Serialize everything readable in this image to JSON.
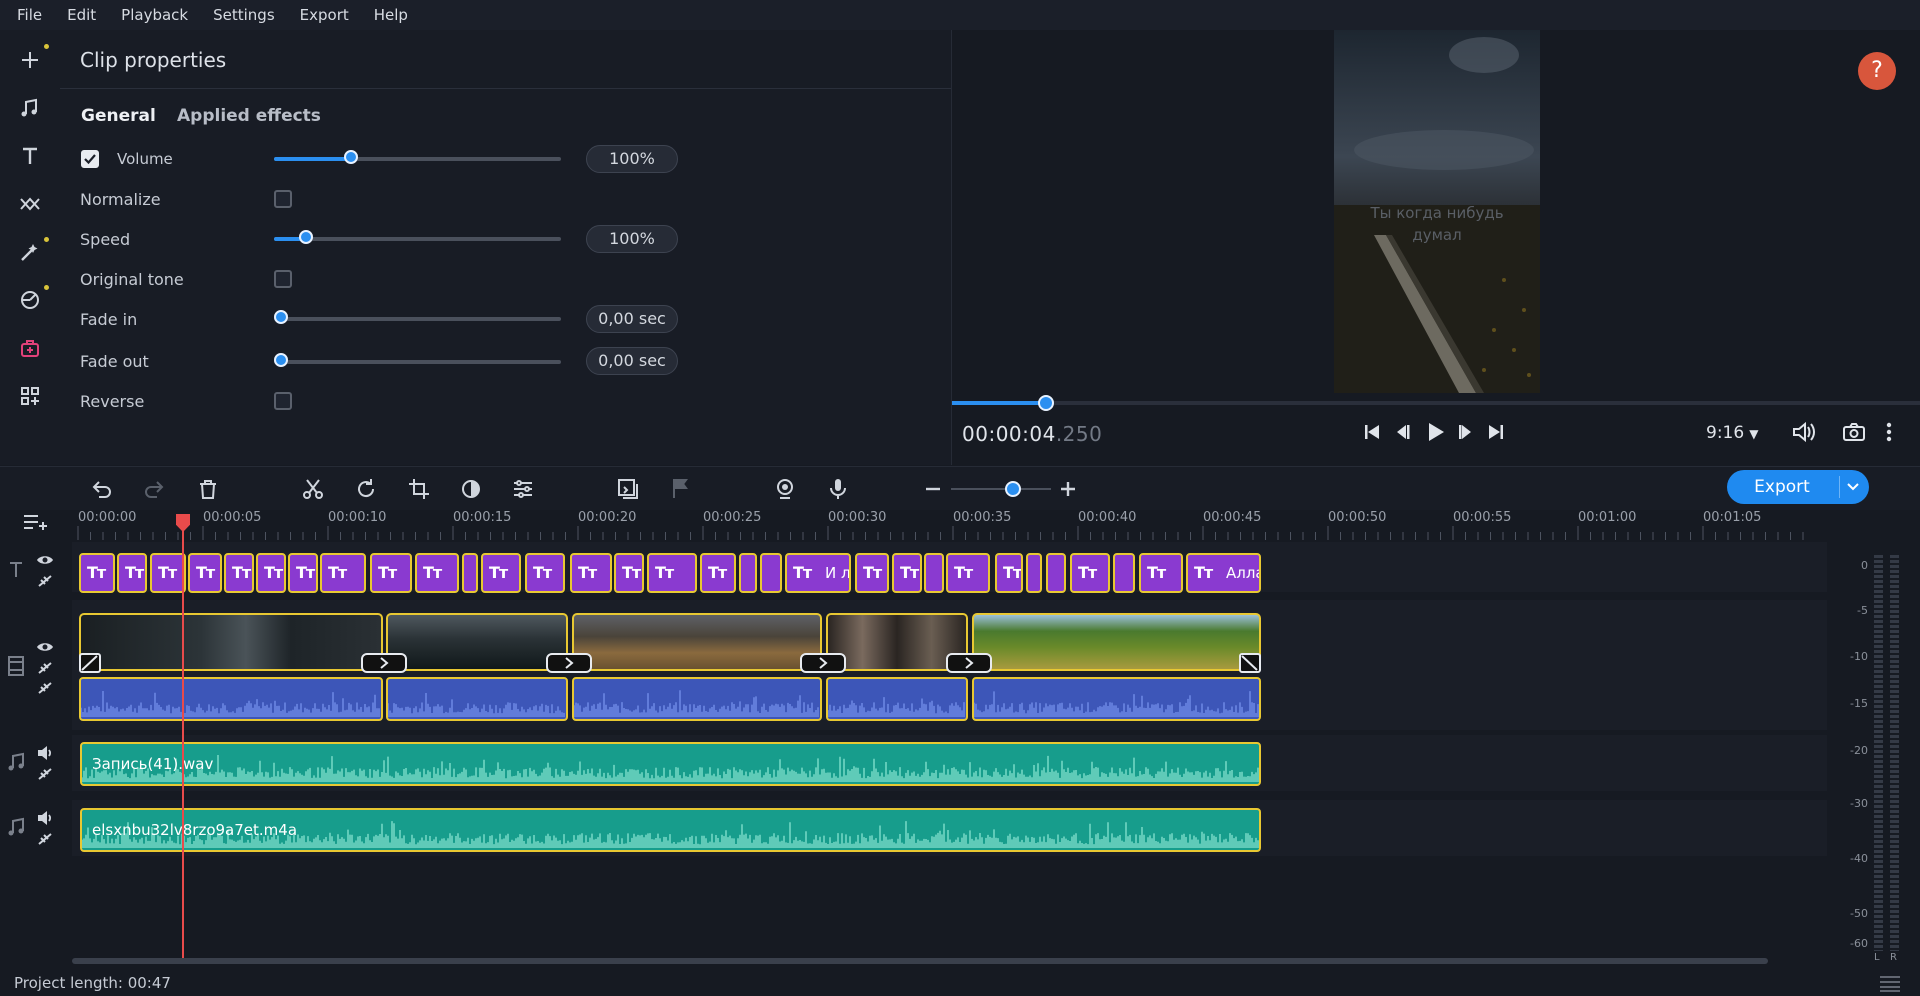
{
  "menu": [
    "File",
    "Edit",
    "Playback",
    "Settings",
    "Export",
    "Help"
  ],
  "props": {
    "title": "Clip properties",
    "tabs": [
      "General",
      "Applied effects"
    ],
    "volume_label": "Volume",
    "volume_value": "100%",
    "volume_level": 0.27,
    "normalize_label": "Normalize",
    "speed_label": "Speed",
    "speed_value": "100%",
    "speed_level": 0.11,
    "original_tone_label": "Original tone",
    "fade_in_label": "Fade in",
    "fade_in_value": "0,00 sec",
    "fade_out_label": "Fade out",
    "fade_out_value": "0,00 sec",
    "reverse_label": "Reverse"
  },
  "preview": {
    "subtitle_line1": "Ты когда нибудь",
    "subtitle_line2": "думал",
    "timecode": "00:00:04",
    "timecode_ms": ".250",
    "aspect": "9:16",
    "help": "?"
  },
  "toolbar": {
    "export_label": "Export"
  },
  "ruler": [
    "00:00:00",
    "00:00:05",
    "00:00:10",
    "00:00:15",
    "00:00:20",
    "00:00:25",
    "00:00:30",
    "00:00:35",
    "00:00:40",
    "00:00:45",
    "00:00:50",
    "00:00:55",
    "00:01:00",
    "00:01:05"
  ],
  "title_clips": {
    "text_a": "И л",
    "text_b": "Алла:"
  },
  "audio_tracks": [
    "Запись(41).wav",
    "elsxnbu32lv8rzo9a7et.m4a"
  ],
  "meter_scale": [
    "0",
    "-5",
    "-10",
    "-15",
    "-20",
    "-30",
    "-40",
    "-50",
    "-60"
  ],
  "meter_channels": [
    "L",
    "R"
  ],
  "status": {
    "project_length": "Project length: 00:47"
  },
  "colors": {
    "accent": "#2b8ff0",
    "title_clip": "#8a3ad0",
    "clip_border": "#e8c832",
    "audio_clip": "#3d56b8",
    "music_clip": "#179d8c",
    "playhead": "#e84b4b"
  }
}
